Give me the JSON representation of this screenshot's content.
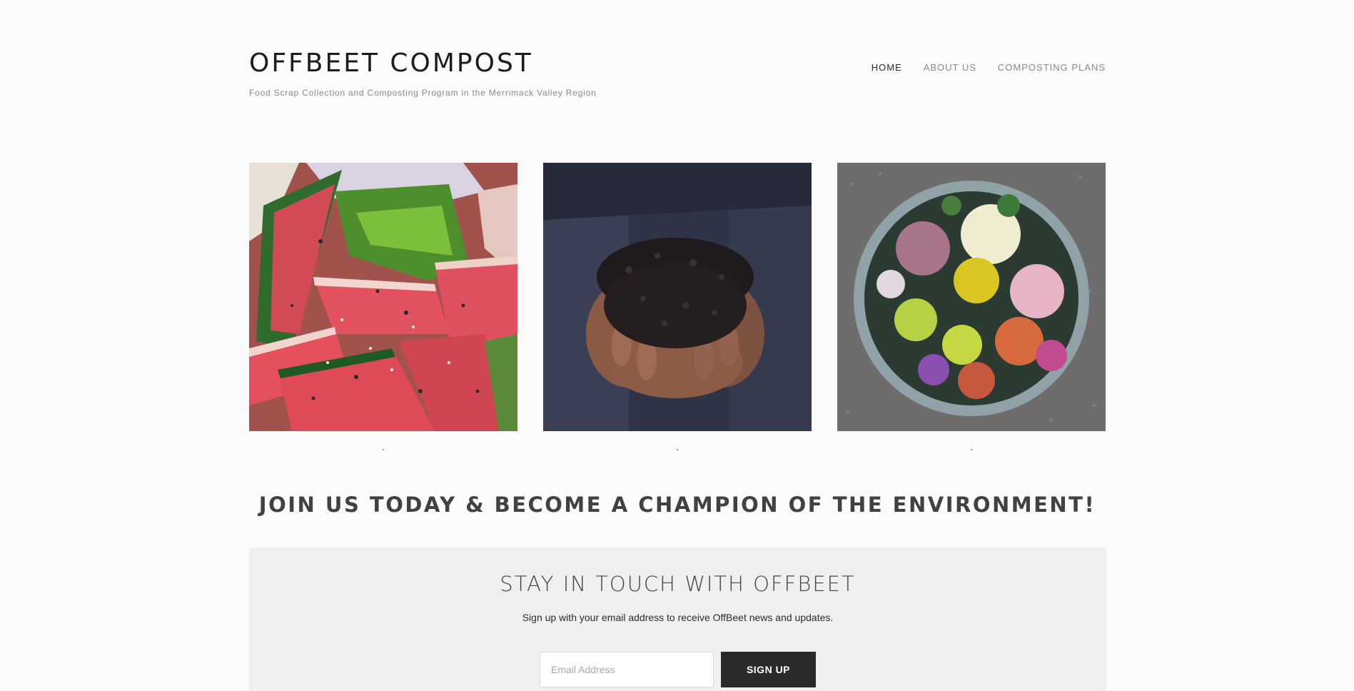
{
  "header": {
    "site_title": "OFFBEET COMPOST",
    "tagline": "Food Scrap Collection and Composting Program in the Merrimack Valley Region",
    "nav": [
      {
        "label": "HOME",
        "active": true
      },
      {
        "label": "ABOUT US",
        "active": false
      },
      {
        "label": "COMPOSTING PLANS",
        "active": false
      }
    ]
  },
  "gallery": {
    "items": [
      {
        "image": "watermelon-scraps-photo"
      },
      {
        "image": "hands-holding-compost-photo"
      },
      {
        "image": "flower-bucket-photo"
      }
    ]
  },
  "cta": {
    "heading": "JOIN US TODAY & BECOME A CHAMPION OF THE ENVIRONMENT!"
  },
  "newsletter": {
    "title": "STAY IN TOUCH WITH OFFBEET",
    "description": "Sign up with your email address to receive OffBeet news and updates.",
    "email_placeholder": "Email Address",
    "button_label": "SIGN UP"
  },
  "colors": {
    "background": "#fbfbfb",
    "newsletter_bg": "#efefef",
    "button_bg": "#2a2a2a",
    "heading": "#414141"
  }
}
